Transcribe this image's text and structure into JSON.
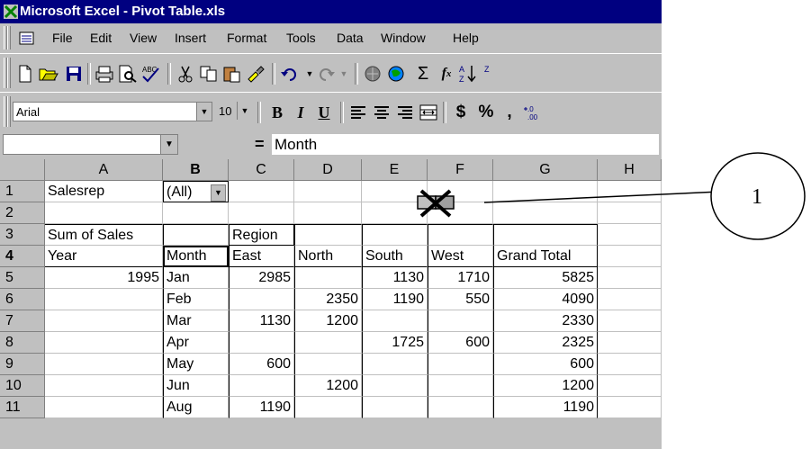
{
  "window": {
    "title": "Microsoft Excel - Pivot Table.xls"
  },
  "menu": [
    "File",
    "Edit",
    "View",
    "Insert",
    "Format",
    "Tools",
    "Data",
    "Window",
    "Help"
  ],
  "standard_toolbar": [
    "new-icon",
    "open-icon",
    "save-icon",
    "print-icon",
    "print-preview-icon",
    "spelling-icon",
    "cut-icon",
    "copy-icon",
    "paste-icon",
    "format-painter-icon",
    "undo-icon",
    "redo-icon",
    "insert-hyperlink-icon",
    "web-toolbar-icon",
    "autosum-icon",
    "function-icon",
    "sort-ascending-icon"
  ],
  "format_toolbar": {
    "font": "Arial",
    "size": "10",
    "bold": "B",
    "italic": "I",
    "underline": "U",
    "currency": "$",
    "percent": "%",
    "comma": ","
  },
  "formula_bar": {
    "equals": "=",
    "content": "Month"
  },
  "columns": [
    "A",
    "B",
    "C",
    "D",
    "E",
    "F",
    "G",
    "H"
  ],
  "rows": [
    "1",
    "2",
    "3",
    "4",
    "5",
    "6",
    "7",
    "8",
    "9",
    "10",
    "11"
  ],
  "cells": {
    "r1": [
      "Salesrep",
      "(All)",
      "",
      "",
      "",
      "",
      "",
      ""
    ],
    "r2": [
      "",
      "",
      "",
      "",
      "",
      "",
      "",
      ""
    ],
    "r3": [
      "Sum of Sales",
      "",
      "Region",
      "",
      "",
      "",
      "",
      ""
    ],
    "r4": [
      "Year",
      "Month",
      "East",
      "North",
      "South",
      "West",
      "Grand Total",
      ""
    ],
    "r5": [
      "1995",
      "Jan",
      "2985",
      "",
      "1130",
      "1710",
      "5825",
      ""
    ],
    "r6": [
      "",
      "Feb",
      "",
      "2350",
      "1190",
      "550",
      "4090",
      ""
    ],
    "r7": [
      "",
      "Mar",
      "1130",
      "1200",
      "",
      "",
      "2330",
      ""
    ],
    "r8": [
      "",
      "Apr",
      "",
      "",
      "1725",
      "600",
      "2325",
      ""
    ],
    "r9": [
      "",
      "May",
      "600",
      "",
      "",
      "",
      "600",
      ""
    ],
    "r10": [
      "",
      "Jun",
      "",
      "1200",
      "",
      "",
      "1200",
      ""
    ],
    "r11": [
      "",
      "Aug",
      "1190",
      "",
      "",
      "",
      "1190",
      ""
    ]
  },
  "callout": {
    "label": "1"
  }
}
